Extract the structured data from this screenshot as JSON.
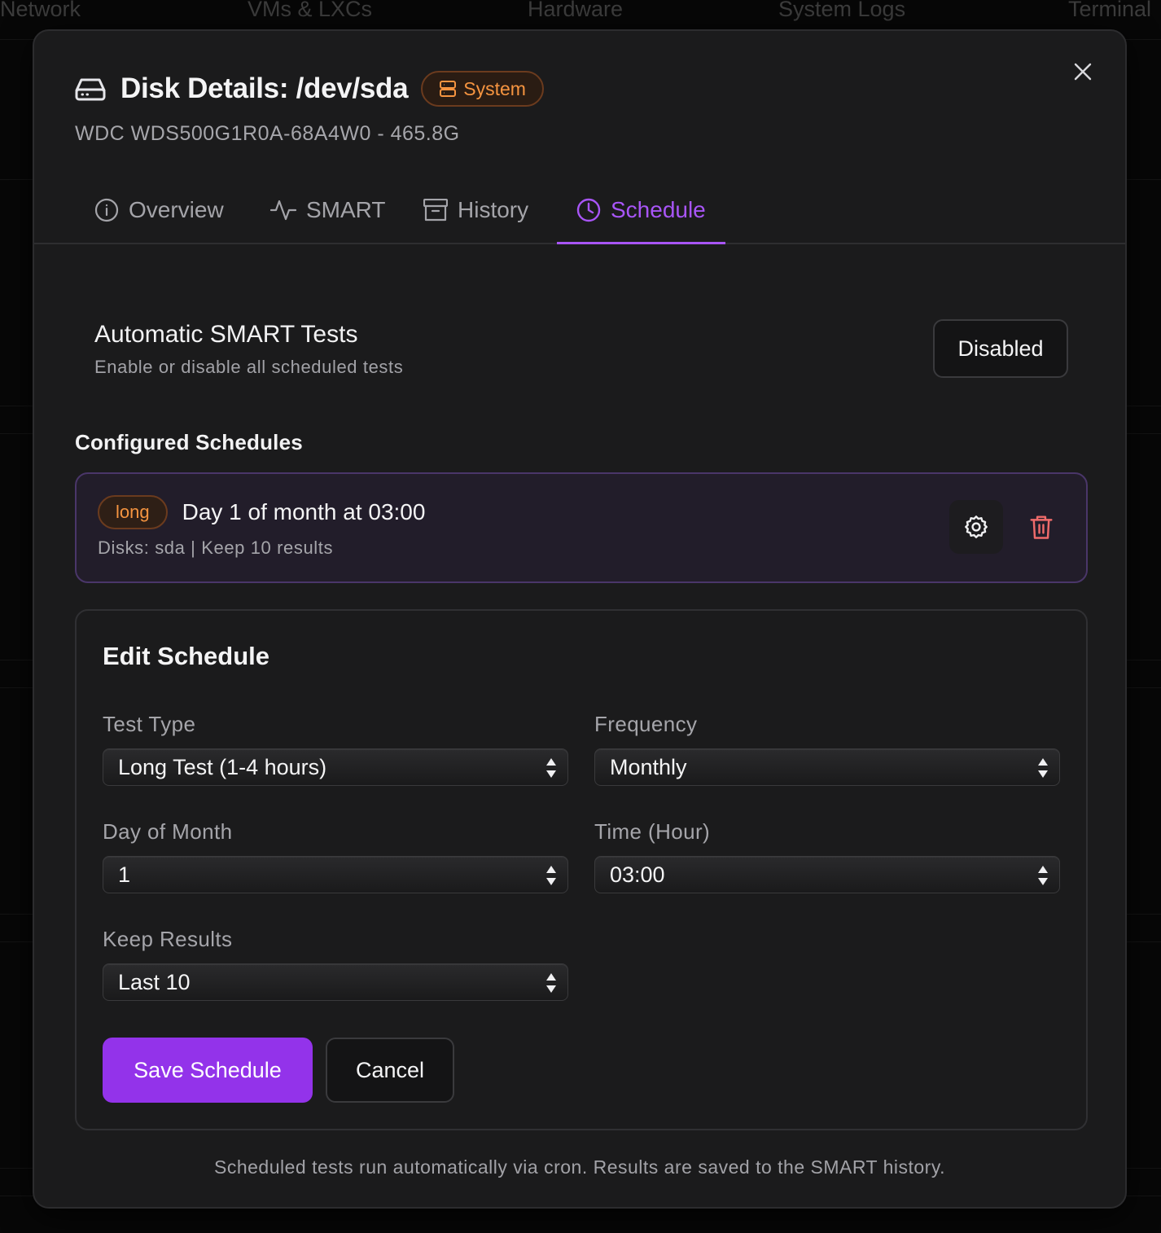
{
  "background": {
    "nav_items": [
      "Network",
      "VMs & LXCs",
      "Hardware",
      "System Logs",
      "Terminal"
    ]
  },
  "modal": {
    "title": "Disk Details: /dev/sda",
    "badge": "System",
    "subtitle": "WDC WDS500G1R0A-68A4W0 - 465.8G",
    "tabs": [
      {
        "label": "Overview",
        "icon": "info-icon"
      },
      {
        "label": "SMART",
        "icon": "activity-icon"
      },
      {
        "label": "History",
        "icon": "archive-icon"
      },
      {
        "label": "Schedule",
        "icon": "clock-icon",
        "active": true
      }
    ],
    "auto_tests": {
      "title": "Automatic SMART Tests",
      "subtitle": "Enable or disable all scheduled tests",
      "toggle_label": "Disabled"
    },
    "configured_title": "Configured Schedules",
    "schedules": [
      {
        "type_badge": "long",
        "description": "Day 1 of month at 03:00",
        "meta": "Disks: sda | Keep 10 results"
      }
    ],
    "edit": {
      "title": "Edit Schedule",
      "test_type_label": "Test Type",
      "test_type_value": "Long Test (1-4 hours)",
      "frequency_label": "Frequency",
      "frequency_value": "Monthly",
      "day_label": "Day of Month",
      "day_value": "1",
      "time_label": "Time (Hour)",
      "time_value": "03:00",
      "keep_label": "Keep Results",
      "keep_value": "Last 10",
      "save_label": "Save Schedule",
      "cancel_label": "Cancel"
    },
    "footer": "Scheduled tests run automatically via cron. Results are saved to the SMART history."
  },
  "colors": {
    "accent": "#a855f7",
    "primary_button": "#9333ea",
    "badge_orange": "#f59440",
    "danger": "#ef6b6b"
  }
}
